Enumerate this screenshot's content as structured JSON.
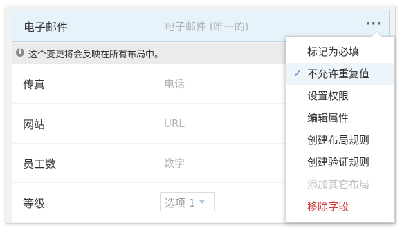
{
  "fields": {
    "email": {
      "label": "电子邮件",
      "value": "电子邮件 (唯一的)"
    },
    "fax": {
      "label": "传真",
      "value": "电话"
    },
    "website": {
      "label": "网站",
      "value": "URL"
    },
    "staff": {
      "label": "员工数",
      "value": "数字"
    },
    "level": {
      "label": "等级",
      "select_value": "选项 1"
    }
  },
  "notice": {
    "text": "这个变更将会反映在所有布局中。"
  },
  "more_button": {
    "label": "···"
  },
  "menu": {
    "items": [
      {
        "label": "标记为必填"
      },
      {
        "label": "不允许重复值",
        "checked": true
      },
      {
        "label": "设置权限"
      },
      {
        "label": "编辑属性"
      },
      {
        "label": "创建布局规则"
      },
      {
        "label": "创建验证规则"
      },
      {
        "label": "添加其它布局",
        "disabled": true
      },
      {
        "label": "移除字段",
        "danger": true
      }
    ],
    "check_mark": "✓"
  },
  "colors": {
    "accent": "#3a7bbf",
    "danger": "#d0393b",
    "selected_row_bg": "#e7f3fb"
  }
}
